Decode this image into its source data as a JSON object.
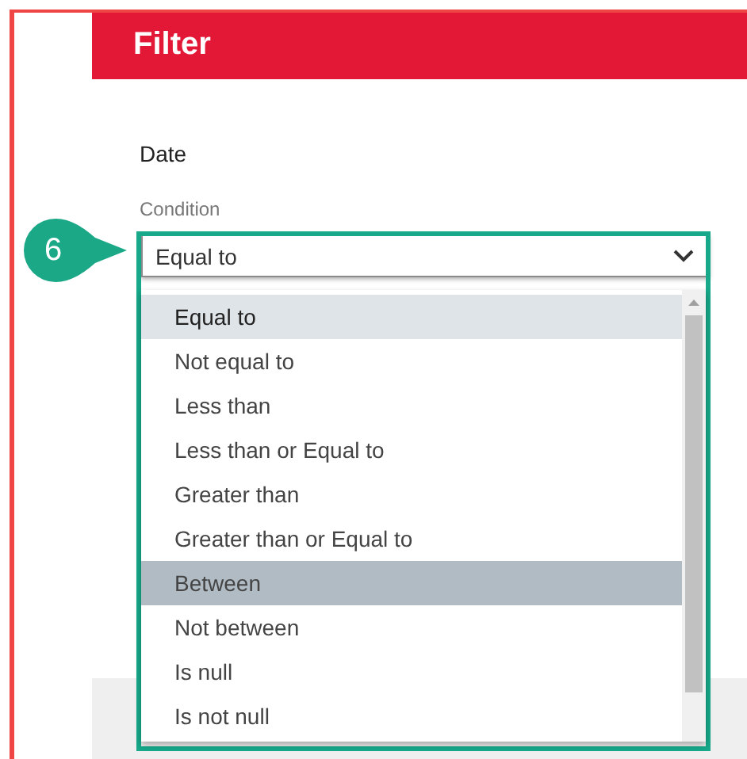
{
  "header": {
    "title": "Filter"
  },
  "field": {
    "label": "Date"
  },
  "condition": {
    "label": "Condition",
    "value": "Equal to",
    "expanded": true
  },
  "options": [
    {
      "label": "Equal to",
      "selected": true,
      "hovered": false
    },
    {
      "label": "Not equal to",
      "selected": false,
      "hovered": false
    },
    {
      "label": "Less than",
      "selected": false,
      "hovered": false
    },
    {
      "label": "Less than or Equal to",
      "selected": false,
      "hovered": false
    },
    {
      "label": "Greater than",
      "selected": false,
      "hovered": false
    },
    {
      "label": "Greater than or Equal to",
      "selected": false,
      "hovered": false
    },
    {
      "label": "Between",
      "selected": false,
      "hovered": true
    },
    {
      "label": "Not between",
      "selected": false,
      "hovered": false
    },
    {
      "label": "Is null",
      "selected": false,
      "hovered": false
    },
    {
      "label": "Is not null",
      "selected": false,
      "hovered": false
    }
  ],
  "callout": {
    "number": "6"
  }
}
